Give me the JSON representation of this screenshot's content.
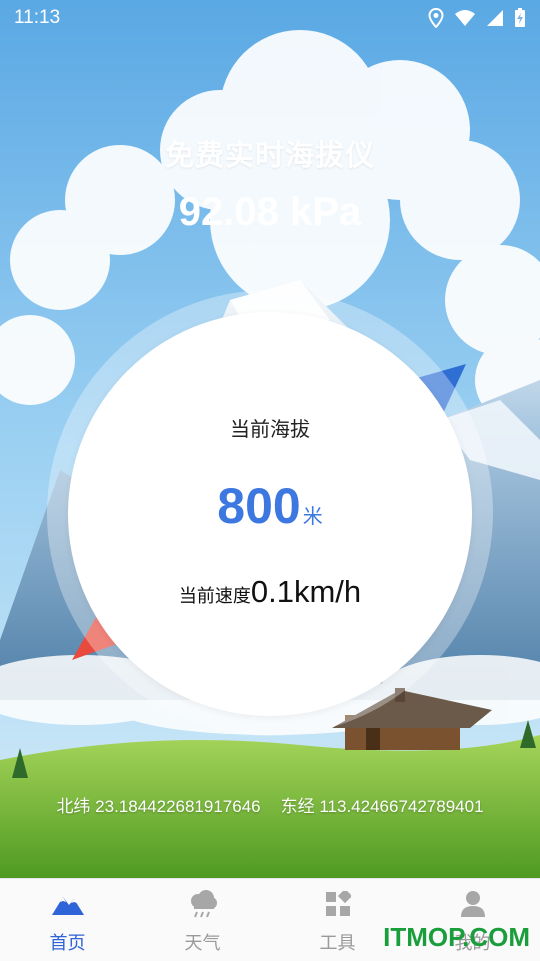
{
  "status_bar": {
    "time": "11:13"
  },
  "header": {
    "title": "免费实时海拔仪",
    "pressure": "92.08 kPa"
  },
  "gauge": {
    "altitude_label": "当前海拔",
    "altitude_value": "800",
    "altitude_unit": "米",
    "speed_label": "当前速度",
    "speed_value": "0.1km/h"
  },
  "location": {
    "latitude": "北纬 23.184422681917646",
    "longitude": "东经 113.42466742789401"
  },
  "bottom_nav": {
    "items": [
      {
        "label": "首页",
        "icon": "mountain-icon",
        "active": true
      },
      {
        "label": "天气",
        "icon": "weather-icon",
        "active": false
      },
      {
        "label": "工具",
        "icon": "tools-icon",
        "active": false
      },
      {
        "label": "我的",
        "icon": "profile-icon",
        "active": false
      }
    ]
  },
  "watermark": "ITMOP.COM",
  "colors": {
    "accent": "#3d78e0",
    "nav_active": "#2f63d8",
    "sky": "#8cc6ee",
    "grass": "#7bbf3a"
  }
}
